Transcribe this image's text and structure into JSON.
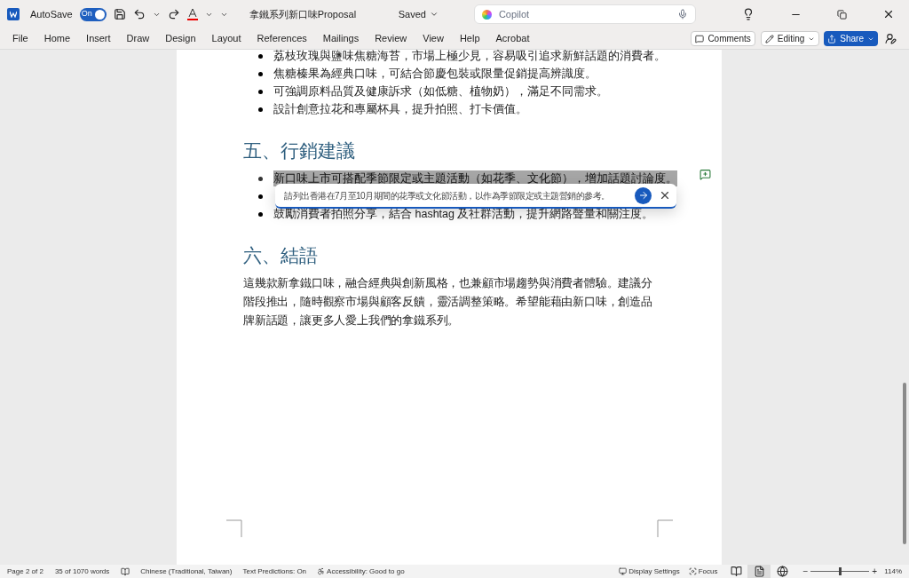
{
  "title_bar": {
    "autosave_label": "AutoSave",
    "autosave": {
      "on": true,
      "label": "On"
    },
    "doc_title": "拿鐵系列新口味Proposal",
    "saved": "Saved",
    "search_placeholder": "Copilot"
  },
  "menu": [
    {
      "label": "File",
      "selected": false
    },
    {
      "label": "Home",
      "selected": false
    },
    {
      "label": "Insert",
      "selected": false
    },
    {
      "label": "Draw",
      "selected": false
    },
    {
      "label": "Design",
      "selected": false
    },
    {
      "label": "Layout",
      "selected": false
    },
    {
      "label": "References",
      "selected": false
    },
    {
      "label": "Mailings",
      "selected": false
    },
    {
      "label": "Review",
      "selected": false
    },
    {
      "label": "View",
      "selected": false
    },
    {
      "label": "Help",
      "selected": false
    },
    {
      "label": "Acrobat",
      "selected": false
    }
  ],
  "ribbon_buttons": {
    "comments": "Comments",
    "editing": "Editing",
    "share": "Share"
  },
  "document": {
    "blocks": [
      {
        "kind": "bullets",
        "items": [
          {
            "text": "荔枝玫瑰與鹽味焦糖海苔，市場上極少見，容易吸引追求新鮮話題的消費者。",
            "selected": false
          },
          {
            "text": "焦糖榛果為經典口味，可結合節慶包裝或限量促銷提高辨識度。",
            "selected": false
          },
          {
            "text": "可強調原料品質及健康訴求（如低糖、植物奶），滿足不同需求。",
            "selected": false
          },
          {
            "text": "設計創意拉花和專屬杯具，提升拍照、打卡價值。",
            "selected": false
          }
        ]
      },
      {
        "kind": "heading",
        "text": "五、行銷建議"
      },
      {
        "kind": "bullets",
        "items": [
          {
            "text": "新口味上市可搭配季節限定或主題活動（如花季、文化節），增加話題討論度。",
            "selected": true
          },
          {
            "selected": false
          },
          {
            "text": "鼓勵消費者拍照分享，結合 hashtag 及社群活動，提升網路聲量和關注度。",
            "selected": false
          }
        ]
      },
      {
        "kind": "heading",
        "text": "六、結語"
      },
      {
        "kind": "paragraph",
        "text": "這幾款新拿鐵口味，融合經典與創新風格，也兼顧市場趨勢與消費者體驗。建議分階段推出，隨時觀察市場與顧客反饋，靈活調整策略。希望能藉由新口味，創造品牌新話題，讓更多人愛上我們的拿鐵系列。"
      }
    ]
  },
  "prompt_popup": {
    "value": "請列出香港在7月至10月期間的花季或文化節活動，以作為季節限定或主題營銷的參考。"
  },
  "status_bar": {
    "page": "Page 2 of 2",
    "words": "35 of 1070 words",
    "language": "Chinese (Traditional, Taiwan)",
    "predictions": "Text Predictions: On",
    "accessibility": "Accessibility: Good to go",
    "display": "Display Settings",
    "focus": "Focus",
    "views": [
      {
        "kind": "read",
        "selected": false
      },
      {
        "kind": "print",
        "selected": true
      },
      {
        "kind": "web",
        "selected": false
      }
    ],
    "zoom": {
      "level": 0.5,
      "label": "114%",
      "minus": "−",
      "plus": "+"
    }
  }
}
